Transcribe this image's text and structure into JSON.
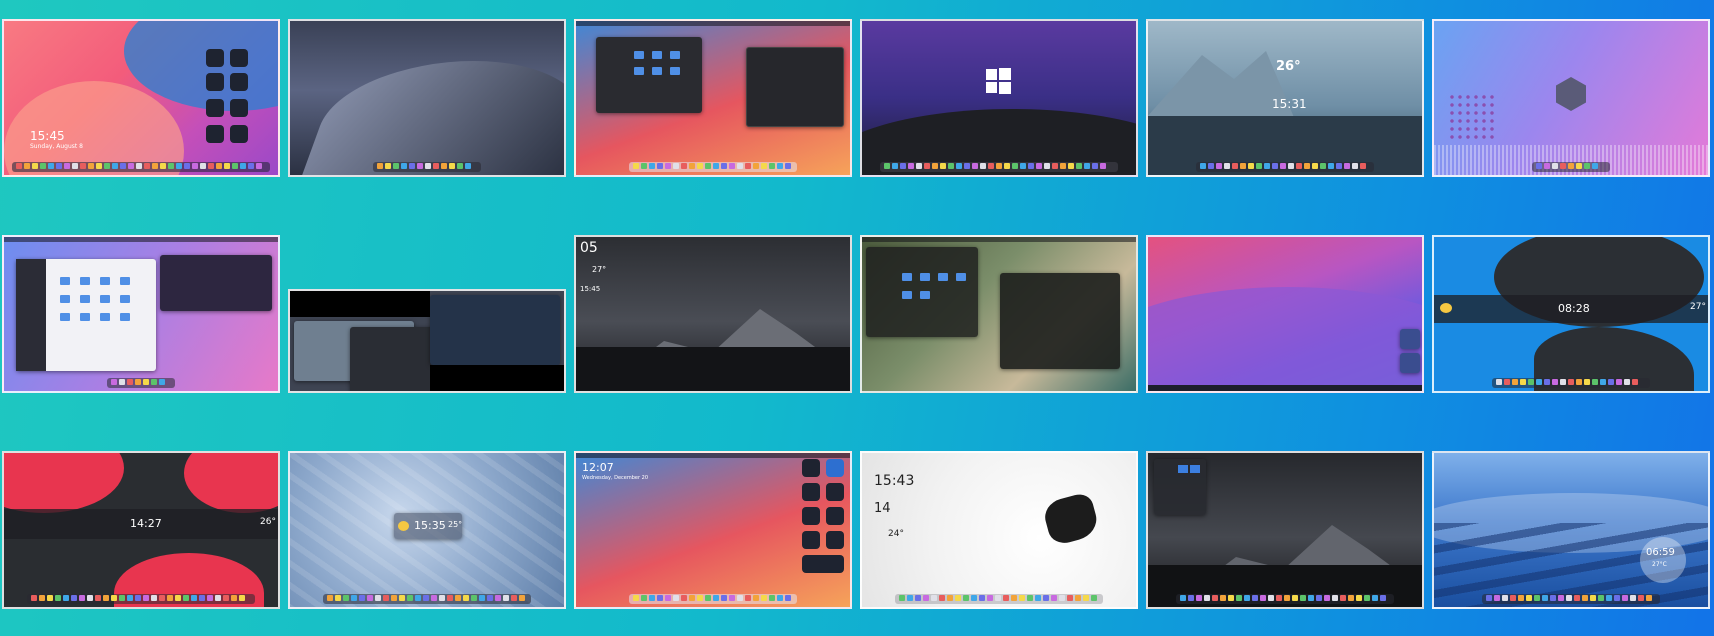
{
  "captions": [
    "",
    "",
    "",
    "",
    "",
    "",
    "",
    "",
    "",
    "",
    "",
    "",
    "",
    "",
    "",
    "",
    "",
    ""
  ],
  "tiles": {
    "t1": {
      "time": "15:45",
      "date": "Sunday, August 8"
    },
    "t5": {
      "temp": "26°",
      "time": "15:31"
    },
    "t9": {
      "day": "05",
      "temp": "27°",
      "time": "15:45"
    },
    "t12": {
      "time": "08:28",
      "temp": "27°"
    },
    "t13": {
      "time": "14:27",
      "temp": "26°"
    },
    "t14": {
      "time": "15:35",
      "temp": "25°"
    },
    "t15": {
      "time": "12:07",
      "date": "Wednesday, December 20"
    },
    "t16": {
      "time": "15:43",
      "day": "14",
      "temp": "24°"
    },
    "t18": {
      "time": "06:59",
      "temp": "27°C"
    }
  },
  "colors": {
    "background_start": "#1fc8c0",
    "background_end": "#1273e8",
    "accent": "#4f8fe6"
  }
}
